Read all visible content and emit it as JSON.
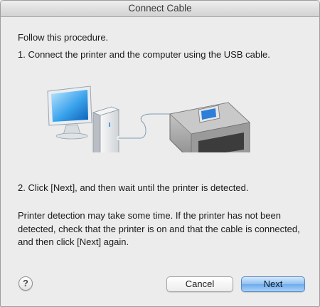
{
  "window": {
    "title": "Connect Cable"
  },
  "body": {
    "intro": "Follow this procedure.",
    "step1": "1. Connect the printer and the computer using the USB cable.",
    "step2": "2. Click [Next], and then wait until the printer is detected.",
    "note": "Printer detection may take some time. If the printer has not been detected, check that the printer is on and that the cable is connected, and then click [Next] again."
  },
  "illustration": {
    "computer_icon": "desktop-computer-icon",
    "cable_icon": "usb-cable-icon",
    "printer_icon": "printer-icon"
  },
  "buttons": {
    "help_label": "?",
    "cancel_label": "Cancel",
    "next_label": "Next"
  },
  "colors": {
    "window_bg": "#ececec",
    "default_button": "#8fc0f1"
  }
}
